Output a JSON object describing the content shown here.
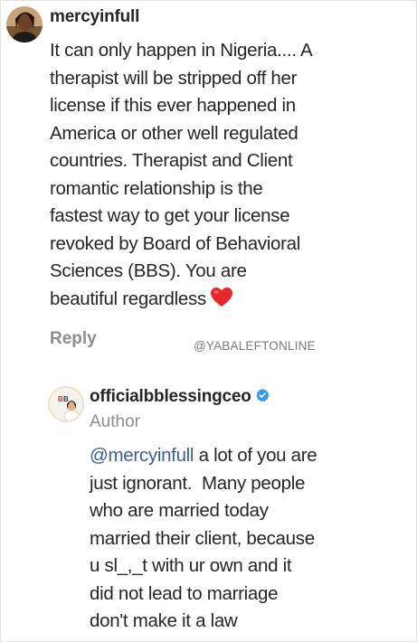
{
  "comment": {
    "username": "mercyinfull",
    "body_lines": [
      "It can only happen in Nigeria.... A",
      "therapist will be stripped off her",
      "license if this ever happened in",
      "America or other well regulated",
      "countries. Therapist and Client",
      "romantic relationship is the",
      "fastest way to get your license",
      "revoked by Board of Behavioral",
      "Sciences (BBS). You are",
      "beautiful regardless"
    ],
    "emoji_icon": "red-heart-icon",
    "reply_label": "Reply"
  },
  "watermark": "@YABALEFTONLINE",
  "reply": {
    "username": "officialbblessingceo",
    "badge_icon": "verified-badge-icon",
    "author_label": "Author",
    "mention": "@mercyinfull",
    "first_line_rest": " a lot of you are",
    "body_lines": [
      "just ignorant.  Many people",
      "who are married today",
      "married their client, because",
      "u sl_,_t with ur own and it",
      "did not lead to marriage",
      "don't make it a law"
    ]
  },
  "colors": {
    "text": "#262626",
    "secondary": "#8e8e8e",
    "mention": "#385e9d",
    "heart": "#e8272d",
    "verified": "#3897f0"
  }
}
